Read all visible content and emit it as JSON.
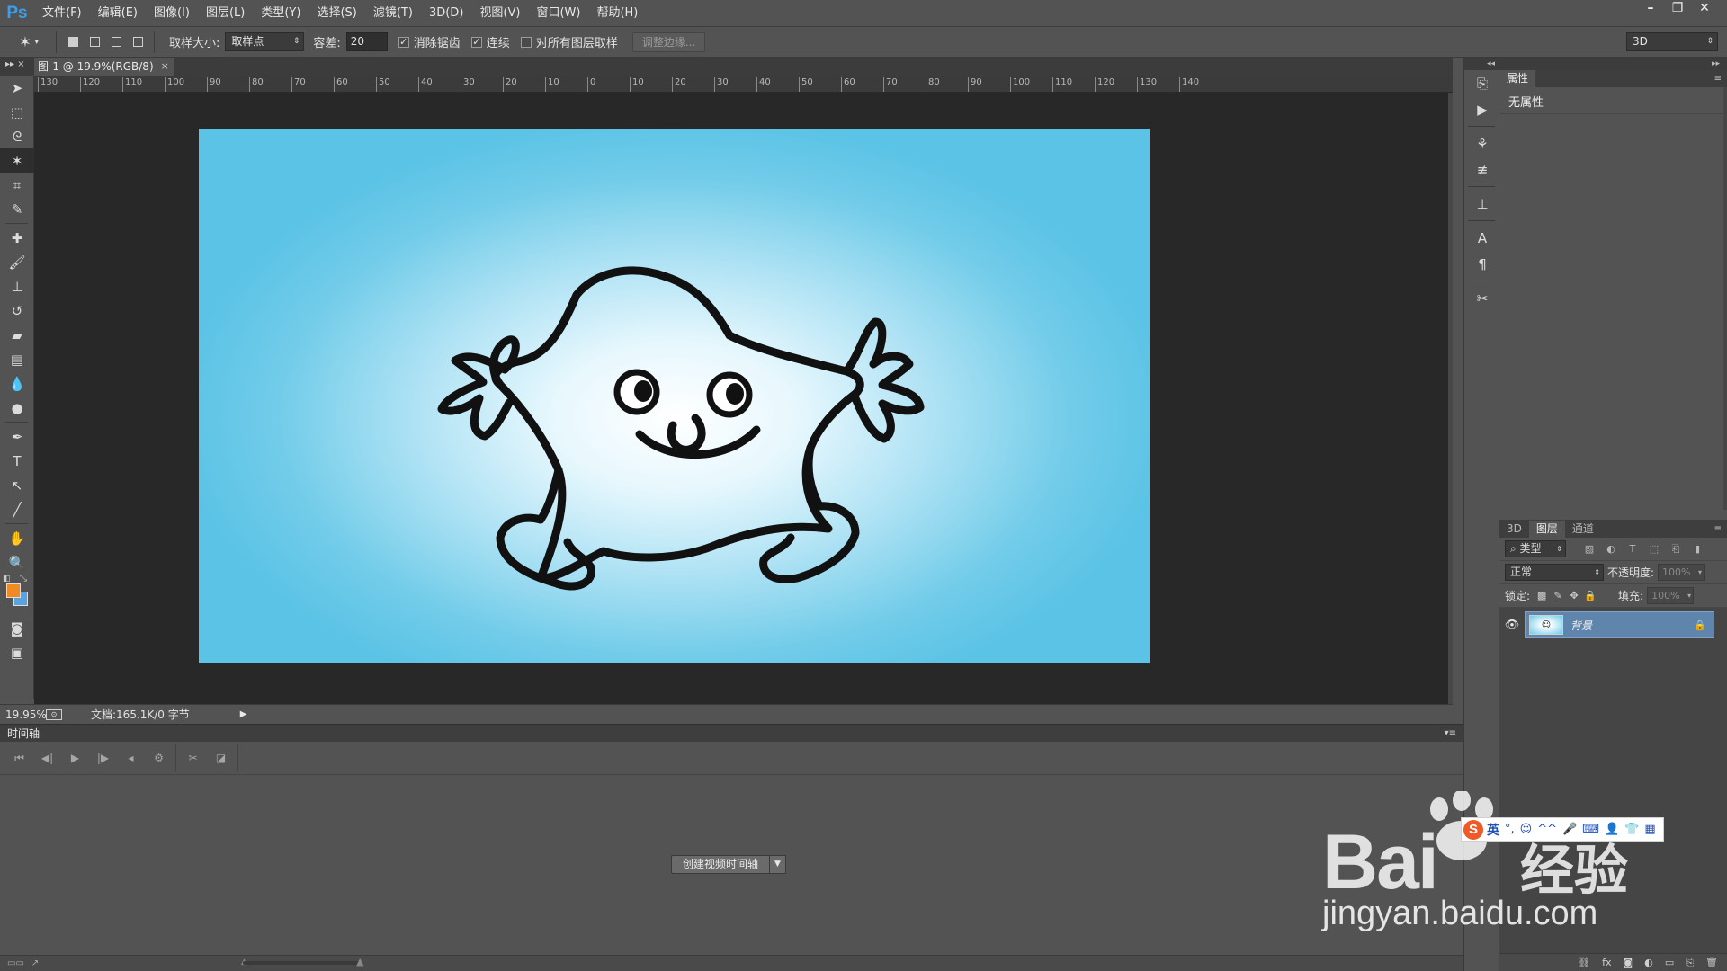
{
  "app": {
    "logo": "Ps",
    "menu": [
      "文件(F)",
      "编辑(E)",
      "图像(I)",
      "图层(L)",
      "类型(Y)",
      "选择(S)",
      "滤镜(T)",
      "3D(D)",
      "视图(V)",
      "窗口(W)",
      "帮助(H)"
    ],
    "window_controls": [
      "minimize-icon",
      "restore-icon",
      "close-icon"
    ]
  },
  "options": {
    "tool_icon": "magic-wand-icon",
    "sample_size_label": "取样大小:",
    "sample_size_value": "取样点",
    "tolerance_label": "容差:",
    "tolerance_value": "20",
    "antialias_label": "消除锯齿",
    "antialias_checked": true,
    "contiguous_label": "连续",
    "contiguous_checked": true,
    "all_layers_label": "对所有图层取样",
    "all_layers_checked": false,
    "refine_edge_label": "调整边缘...",
    "workspace_value": "3D"
  },
  "document": {
    "tab_title": "图-1 @ 19.9%(RGB/8)",
    "tab_close": "×",
    "ruler_labels": [
      "130",
      "120",
      "110",
      "100",
      "90",
      "80",
      "70",
      "60",
      "50",
      "40",
      "30",
      "20",
      "10",
      "0",
      "10",
      "20",
      "30",
      "40",
      "50",
      "60",
      "70",
      "80",
      "90",
      "100",
      "110",
      "120",
      "130",
      "140"
    ],
    "canvas_colors": {
      "center": "#ffffff",
      "edge": "#5bc3e6",
      "stroke": "#111111"
    }
  },
  "status": {
    "zoom": "19.95%",
    "doc_info": "文档:165.1K/0 字节"
  },
  "timeline": {
    "title": "时间轴",
    "create_button": "创建视频时间轴"
  },
  "properties": {
    "tab": "属性",
    "empty_text": "无属性"
  },
  "layers": {
    "tabs": [
      "3D",
      "图层",
      "通道"
    ],
    "active_tab": "图层",
    "filter_label": "类型",
    "blend_mode": "正常",
    "opacity_label": "不透明度:",
    "opacity_value": "100%",
    "lock_label": "锁定:",
    "fill_label": "填充:",
    "fill_value": "100%",
    "items": [
      {
        "name": "背景",
        "visible": true,
        "locked": true,
        "selected": true
      }
    ]
  },
  "colors": {
    "foreground": "#f08a24",
    "background": "#5aa2e0",
    "accent": "#3aa0ee"
  },
  "watermark": {
    "brand": "Bai",
    "brand_cn": "经验",
    "url": "jingyan.baidu.com"
  },
  "ime": {
    "logo": "S",
    "lang": "英"
  }
}
